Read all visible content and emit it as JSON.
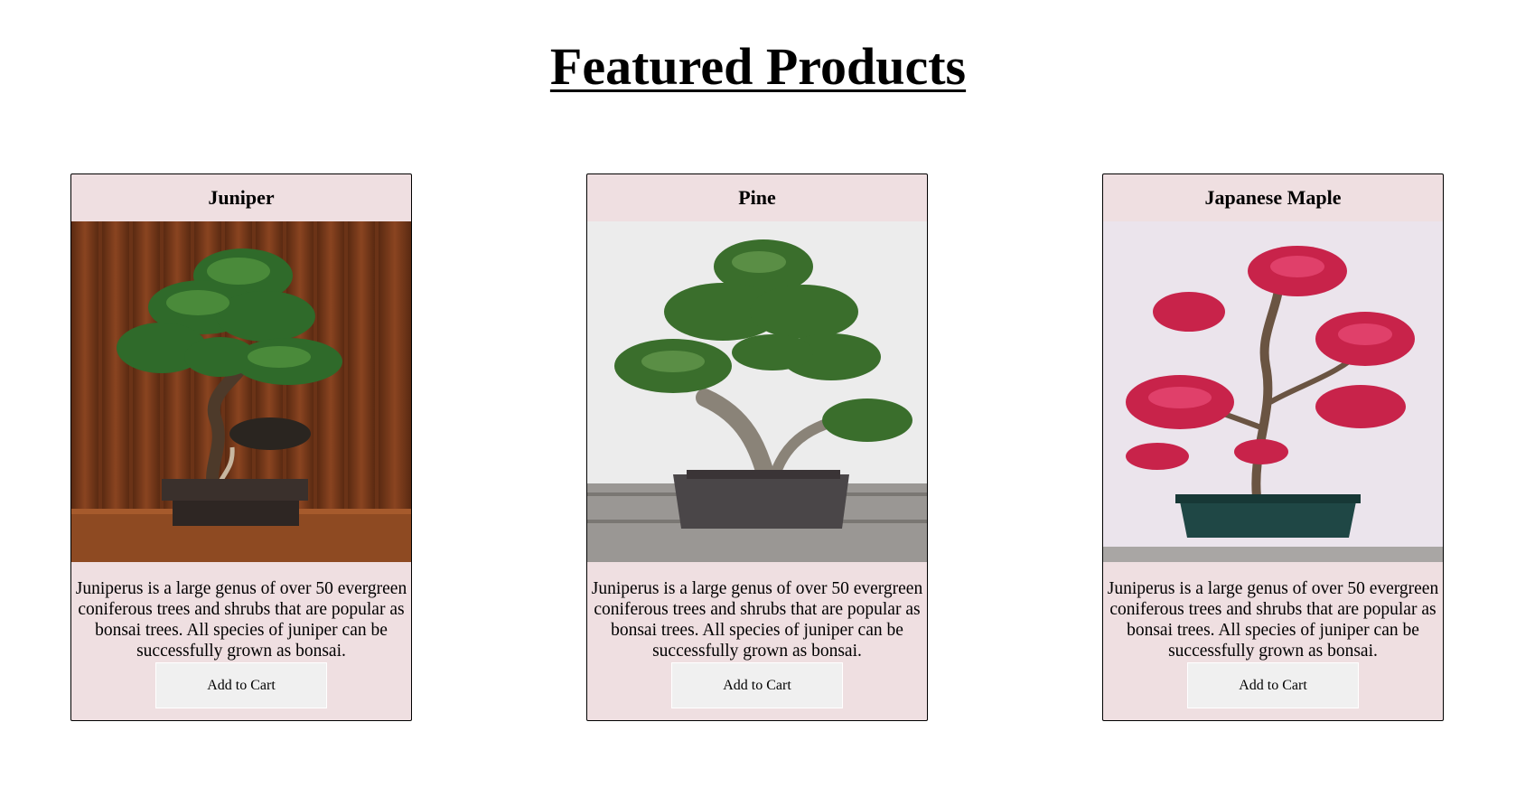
{
  "page": {
    "title": "Featured Products"
  },
  "products": [
    {
      "name": "Juniper",
      "description": "Juniperus is a large genus of over 50 evergreen coniferous trees and shrubs that are popular as bonsai trees. All species of juniper can be successfully grown as bonsai.",
      "button_label": "Add to Cart",
      "image_icon": "juniper-bonsai-photo"
    },
    {
      "name": "Pine",
      "description": "Juniperus is a large genus of over 50 evergreen coniferous trees and shrubs that are popular as bonsai trees. All species of juniper can be successfully grown as bonsai.",
      "button_label": "Add to Cart",
      "image_icon": "pine-bonsai-photo"
    },
    {
      "name": "Japanese Maple",
      "description": "Juniperus is a large genus of over 50 evergreen coniferous trees and shrubs that are popular as bonsai trees. All species of juniper can be successfully grown as bonsai.",
      "button_label": "Add to Cart",
      "image_icon": "maple-bonsai-photo"
    }
  ],
  "colors": {
    "card_background": "#efdfe1",
    "button_background": "#f0f0f0",
    "maple_leaves": "#c8234a",
    "evergreen_foliage": "#3f7a32"
  }
}
